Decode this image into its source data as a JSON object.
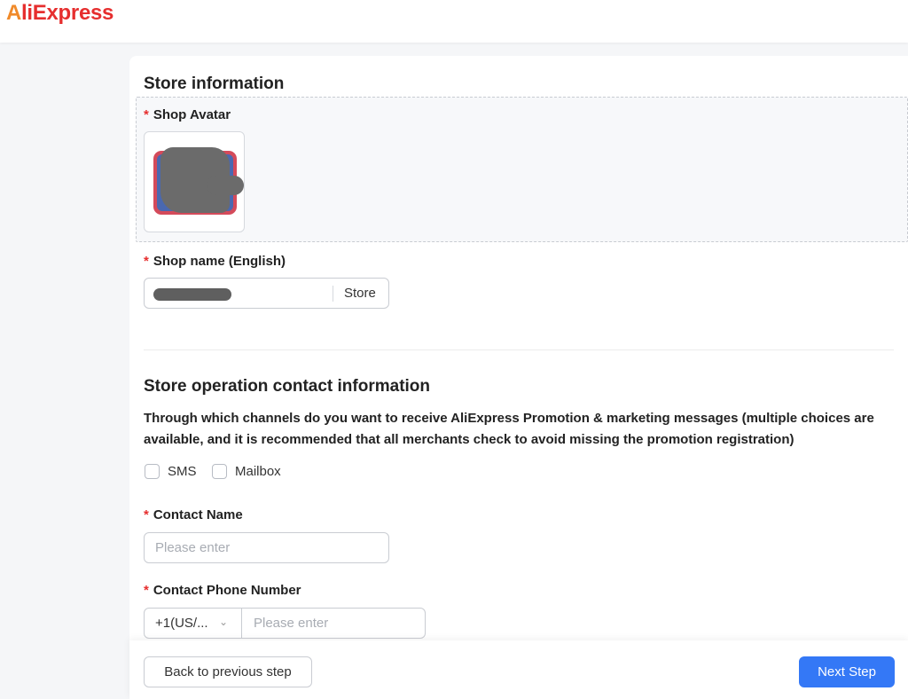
{
  "header": {
    "logo_a": "A",
    "logo_rest": "liExpress"
  },
  "store_info": {
    "title": "Store information",
    "avatar_label": "Shop Avatar",
    "shop_name_label": "Shop name (English)",
    "shop_name_suffix": "Store"
  },
  "contact": {
    "title": "Store operation contact information",
    "channels_question": "Through which channels do you want to receive AliExpress Promotion & marketing messages (multiple choices are available, and it is recommended that all merchants check to avoid missing the promotion registration)",
    "channels": [
      {
        "label": "SMS",
        "checked": false
      },
      {
        "label": "Mailbox",
        "checked": false
      }
    ],
    "contact_name_label": "Contact Name",
    "contact_name_placeholder": "Please enter",
    "phone_label": "Contact Phone Number",
    "phone_country_code": "+1(US/...",
    "phone_placeholder": "Please enter"
  },
  "required_mark": "*",
  "footer": {
    "back_label": "Back to previous step",
    "next_label": "Next Step"
  },
  "colors": {
    "brand_red": "#e62e2e",
    "primary_blue": "#3478f6"
  }
}
